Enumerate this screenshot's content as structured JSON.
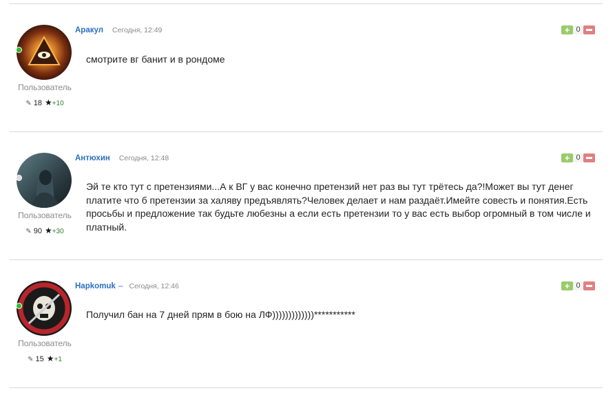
{
  "comments": [
    {
      "author": "Аракул",
      "separator": "",
      "time": "Сегодня, 12:49",
      "role": "Пользователь",
      "posts": "18",
      "reputation": "+10",
      "online": true,
      "votes": "0",
      "text": "смотрите вг банит и в рондоме",
      "avatar_icon": "eye-pyramid-avatar-icon"
    },
    {
      "author": "Антюхин",
      "separator": "",
      "time": "Сегодня, 12:48",
      "role": "Пользователь",
      "posts": "90",
      "reputation": "+30",
      "online": false,
      "votes": "0",
      "text": "Эй те кто тут с претензиями...А к ВГ у вас конечно претензий нет раз вы тут трётесь да?!Может вы тут денег платите что б претензии за халяву предъявлять?Человек делает и нам раздаёт.Имейте совесть и понятия.Есть просьбы и предложение так будьте любезны а если есть претензии то у вас есть выбор огромный в том числе и платный.",
      "avatar_icon": "hooded-figure-avatar-icon"
    },
    {
      "author": "Hapkomuk",
      "separator": "–",
      "time": "Сегодня, 12:46",
      "role": "Пользователь",
      "posts": "15",
      "reputation": "+1",
      "online": true,
      "votes": "0",
      "text": "Получил бан на 7 дней прям в бою на ЛФ)))))))))))))***********",
      "avatar_icon": "skull-emblem-avatar-icon"
    }
  ],
  "colors": {
    "author_link": "#2a6fc0",
    "online": "#2bbd2b",
    "vote_up": "#9bcb69",
    "vote_down": "#e27f7f"
  }
}
